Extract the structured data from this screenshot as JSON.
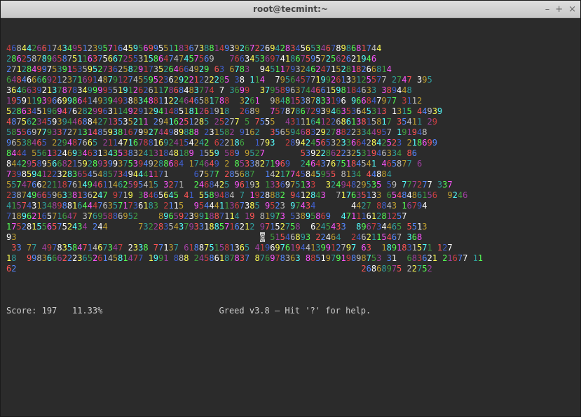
{
  "window": {
    "title": "root@tecmint:~",
    "minimize_glyph": "–",
    "maximize_glyph": "+",
    "close_glyph": "×"
  },
  "game": {
    "cursor_glyph": "@",
    "cursor_row": 15,
    "cursor_col": 51,
    "rows": [
      "46844266174349512395716459569955118367388149392672269428345653467898681744 ",
      "28625878965875116375667255315864747457569   76634536974186759572562621946  ",
      "2712849975391535952736258291735264664929 63 6783  94511793246247152818266814  ",
      "64846666921237169148791274559523629221222285 38 114  7956457719926133125577 2747 395  ",
      "36466392137878349999551912626117868483774 7 3699  37958963744661598184633 389448  ",
      "19591193966998641493949388348811224646581788  3261  984815387833196 966847977 3112  ",
      "52863451969476282996311492912941485181261918  2689  75787867293946353645313 1315 44939  ",
      "4875623459394468842713535211 29416251285 25277 5 7555  431116412268613815817 35411 29  ",
      "58556977933727131485938167992744989888 231582 9162  356594683292788223344957 191948  ",
      "96538465 229487665 211471678816924154242 622186  1793  28942456532336642842523 218699  ",
      "8444 55613246934631343538324131848189 1559 589 9527       53922862232531946334 86  ",
      "84429589566821592893993753949288684 174649 2 85338271969  246437675184541 465877 6  ",
      "73985941223283654548573494441171     67577 285687  14217745845955 8134 44884  ",
      "557476622118761494611462595415 3271  2468425 96193 1336975133  32494829535 59 777277 337  ",
      "23874966596338136247 9719 38465645 41 5589484 7 1928882 9412843  717635133 6548486156  9246  ",
      "415743134898816444763571736183 2115  9544411367385 9523 97434       4427 8843 16794  ",
      "71896216571647 37695886952    8965923991887114 19 81973 53895869  4711161281257  ",
      "1752815565752434 244      73228354379331885716212 97152758  6245433  896734465 5513  ",
      "93                                                @ 51546893 22464  2462115467 368  ",
      " 33 77 4978358471467347 2338 77137 6188751581365 41969761944139912797 63  1891831571 127  ",
      "18  99836662223652614581477 1991 888 24586187837 876978363 885197919898753 31  683621 21677 11  ",
      "62                                                                    26868975 22752  "
    ]
  },
  "status": {
    "score_label": "Score:",
    "score_value": "197",
    "percent": "11.33%",
    "app_label": "Greed v3.8 – Hit '?' for help."
  },
  "colors": {
    "palette": [
      "#d04040",
      "#40a040",
      "#c0a030",
      "#4060d0",
      "#a040a0",
      "#30a0a0",
      "#c0c0c0",
      "#707070",
      "#ff5555",
      "#55ff55",
      "#ffff55",
      "#5588ff",
      "#ff55ff",
      "#55ffff",
      "#ffffff"
    ]
  }
}
